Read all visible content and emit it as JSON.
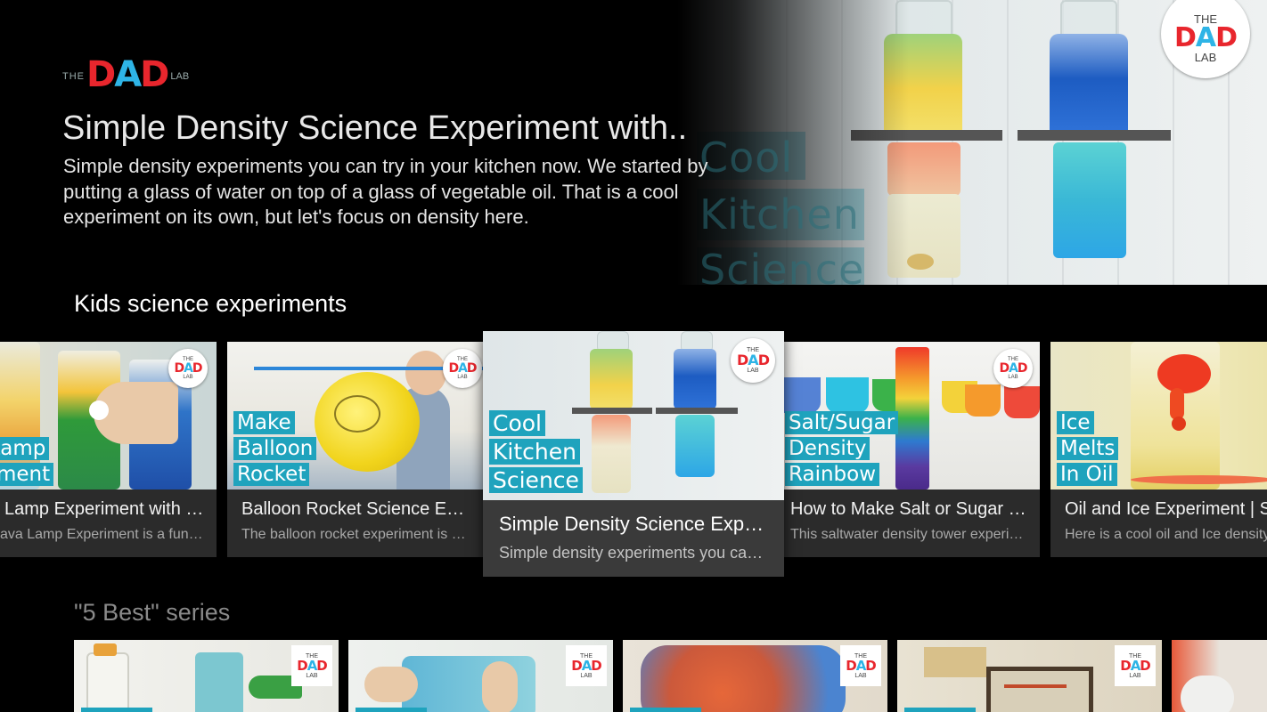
{
  "brand": {
    "logo_the": "THE",
    "logo_dad": "DAD",
    "logo_lab": "LAB",
    "colors": {
      "d": "#e8262d",
      "a": "#2eb4e6",
      "d2": "#e8262d",
      "accent": "#1fa3bd"
    }
  },
  "hero": {
    "title": "Simple Density Science Experiment with..",
    "description": "Simple density experiments you can try in your kitchen now. We started by putting a glass of water on top of a glass of vegetable oil. That is a cool experiment on its own, but let's focus on density here.",
    "image_lines": [
      "Cool",
      "Kitchen",
      "Science"
    ]
  },
  "rows": [
    {
      "title": "Kids science experiments",
      "cards": [
        {
          "title": "Lamp Experiment with Oil…",
          "description": "ava Lamp Experiment is a fun …",
          "thumb_lines": [
            "l",
            "a Lamp",
            "eriment"
          ]
        },
        {
          "title": "Balloon Rocket Science Experi…",
          "description": "The balloon rocket experiment is e…",
          "thumb_lines": [
            "Make",
            "Balloon",
            "Rocket"
          ]
        },
        {
          "title": "Simple Density Science Experi…",
          "description": "Simple density experiments you ca…",
          "thumb_lines": [
            "Cool",
            "Kitchen",
            "Science"
          ]
        },
        {
          "title": "How to Make Salt or Sugar Wat…",
          "description": "This saltwater density tower experi…",
          "thumb_lines": [
            "Salt/Sugar",
            "Density",
            "Rainbow"
          ]
        },
        {
          "title": "Oil and Ice Experiment | Sim",
          "description": "Here is a cool oil and Ice density",
          "thumb_lines": [
            "Ice",
            "Melts",
            "In Oil"
          ]
        }
      ]
    },
    {
      "title": "\"5 Best\" series",
      "cards": [
        {},
        {},
        {},
        {},
        {}
      ]
    }
  ]
}
